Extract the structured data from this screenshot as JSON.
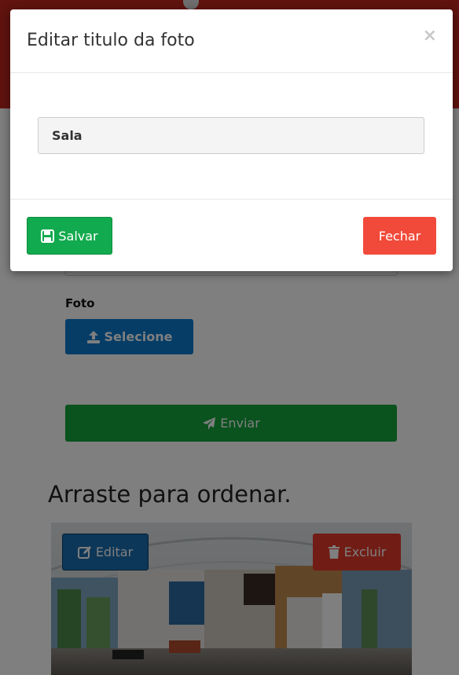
{
  "modal": {
    "title": "Editar titulo da foto",
    "close_glyph": "×",
    "title_input_value": "Sala",
    "save_label": "Salvar",
    "close_label": "Fechar"
  },
  "form": {
    "photo_label": "Foto",
    "select_label": "Selecione",
    "send_label": "Enviar"
  },
  "gallery": {
    "heading": "Arraste para ordenar.",
    "edit_label": "Editar",
    "delete_label": "Excluir"
  },
  "icons": {
    "save": "floppy-disk-icon",
    "upload": "upload-icon",
    "send": "paper-plane-icon",
    "edit": "pencil-square-icon",
    "delete": "trash-icon"
  },
  "colors": {
    "topbar": "#c0271f",
    "save": "#12aa4e",
    "close": "#f14a3a",
    "select": "#0b7bcf",
    "send": "#14a43c",
    "edit": "#1b6fb0",
    "delete": "#e23a2b"
  }
}
